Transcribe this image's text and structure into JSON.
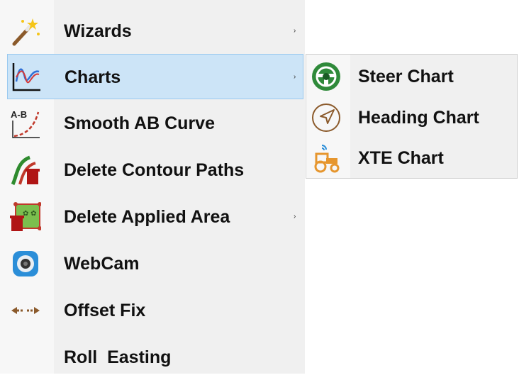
{
  "menu": {
    "items": [
      {
        "label": "Wizards",
        "icon": "magic-wand-icon",
        "has_submenu": true
      },
      {
        "label": "Charts",
        "icon": "chart-line-icon",
        "has_submenu": true,
        "highlighted": true
      },
      {
        "label": "Smooth AB Curve",
        "icon": "ab-curve-icon",
        "has_submenu": false
      },
      {
        "label": "Delete Contour Paths",
        "icon": "delete-contour-icon",
        "has_submenu": false
      },
      {
        "label": "Delete Applied Area",
        "icon": "delete-area-icon",
        "has_submenu": true
      },
      {
        "label": "WebCam",
        "icon": "webcam-icon",
        "has_submenu": false
      },
      {
        "label": "Offset Fix",
        "icon": "offset-arrows-icon",
        "has_submenu": false
      },
      {
        "label": "Roll  Easting",
        "icon": "",
        "has_submenu": false
      }
    ],
    "submenu_arrow": "›"
  },
  "submenu": {
    "items": [
      {
        "label": "Steer Chart",
        "icon": "steering-wheel-icon"
      },
      {
        "label": "Heading Chart",
        "icon": "heading-arrow-icon"
      },
      {
        "label": "XTE Chart",
        "icon": "tractor-icon"
      }
    ]
  },
  "colors": {
    "highlight": "#cce4f7",
    "highlight_border": "#99c9ef",
    "menu_bg": "#f0f0f0"
  }
}
